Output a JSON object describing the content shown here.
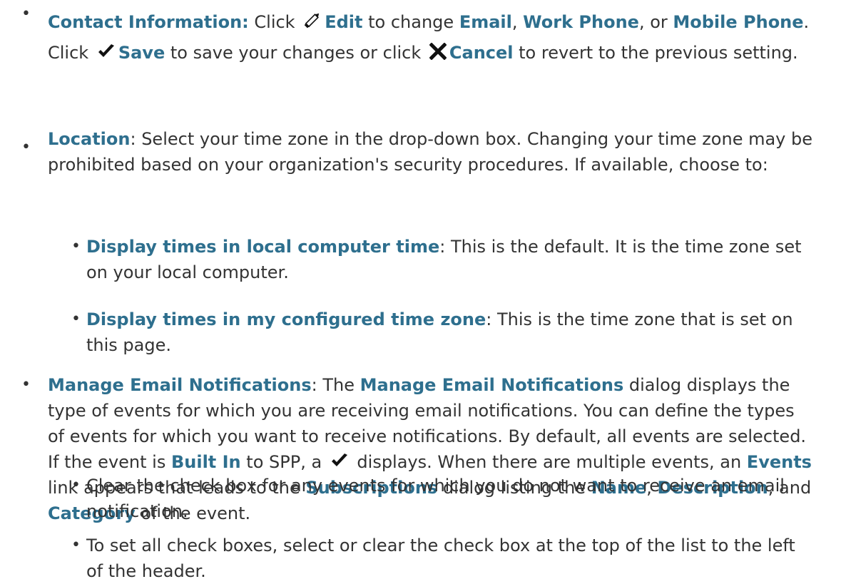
{
  "bullet_char": "•",
  "contact": {
    "label": "Contact Information:",
    "t1": " Click ",
    "edit_icon": "pencil-icon",
    "edit": "Edit",
    "t2": " to change ",
    "email": "Email",
    "t3": ", ",
    "work_phone": "Work Phone",
    "t4": ", or ",
    "mobile_phone": "Mobile Phone",
    "t5": ". Click ",
    "save_icon": "checkmark-icon",
    "save": "Save",
    "t6": " to save your changes or click ",
    "cancel_icon": "x-icon",
    "cancel": "Cancel",
    "t7": " to revert to the previous setting."
  },
  "location": {
    "label": "Location",
    "text": ": Select your time zone in the drop-down box. Changing your time zone may be prohibited based on your organization's security procedures. If available, choose to:",
    "sub": [
      {
        "label": "Display times in local computer time",
        "text": ": This is the default. It is the time zone set on your local computer."
      },
      {
        "label": "Display times in my configured time zone",
        "text": ": This is the time zone that is set on this page."
      }
    ]
  },
  "notifications": {
    "label": "Manage Email Notifications",
    "t1": ": The ",
    "dialog_name": "Manage Email Notifications",
    "t2": " dialog displays the type of events for which you are receiving email notifications. You can define the types of events for which you want to receive notifications. By default, all events are selected. If the event is ",
    "built_in": "Built In",
    "t3": " to SPP, a ",
    "check_icon": "checkmark-icon",
    "t4": " displays. When there are multiple events, an ",
    "events": "Events",
    "t5": " link appears that leads to the ",
    "subscriptions": "Subscriptions",
    "t6": " dialog listing the ",
    "name": "Name",
    "t7": ", ",
    "description": "Description",
    "t8": ", and ",
    "category": "Category",
    "t9": " of the event.",
    "sub": [
      {
        "text": "Clear the check box for any events for which you do not want to receive an email notification."
      },
      {
        "text": "To set all check boxes, select or clear the check box at the top of the list to the left of the header."
      }
    ]
  }
}
